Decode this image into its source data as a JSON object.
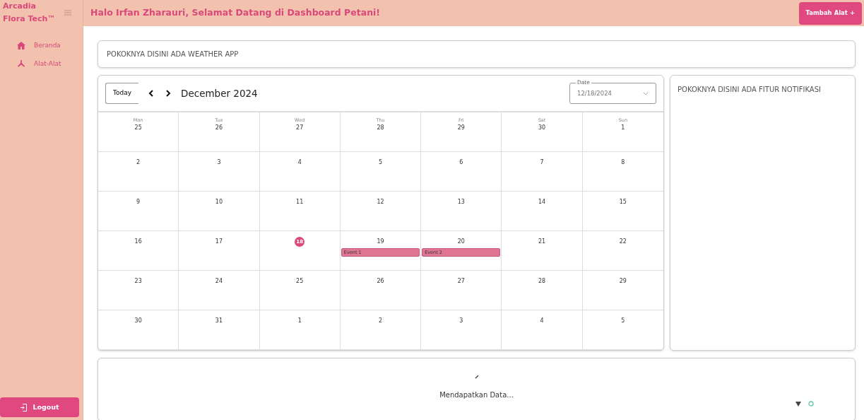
{
  "sidebar": {
    "brand": "Arcadia Flora Tech™",
    "items": [
      {
        "label": "Beranda",
        "kind": "home"
      },
      {
        "label": "Alat-Alat",
        "kind": "tools"
      }
    ],
    "logout": "Logout"
  },
  "header": {
    "greeting": "Halo Irfan Zharauri, Selamat Datang di Dashboard Petani!",
    "add_button": "Tambah Alat +"
  },
  "weather": {
    "text": "POKOKNYA DISINI ADA WEATHER APP"
  },
  "calendar": {
    "today_button": "Today",
    "month": "December 2024",
    "date_field": {
      "label": "Date",
      "value": "12/18/2024"
    },
    "weekdays": [
      "Mon",
      "Tue",
      "Wed",
      "Thu",
      "Fri",
      "Sat",
      "Sun"
    ],
    "weeks": [
      [
        {
          "day": "25",
          "selected": false
        },
        {
          "day": "26",
          "selected": false
        },
        {
          "day": "27",
          "selected": false
        },
        {
          "day": "28",
          "selected": false
        },
        {
          "day": "29",
          "selected": false
        },
        {
          "day": "30",
          "selected": false
        },
        {
          "day": "1",
          "selected": false
        }
      ],
      [
        {
          "day": "2",
          "selected": false
        },
        {
          "day": "3",
          "selected": false
        },
        {
          "day": "4",
          "selected": false
        },
        {
          "day": "5",
          "selected": false
        },
        {
          "day": "6",
          "selected": false
        },
        {
          "day": "7",
          "selected": false
        },
        {
          "day": "8",
          "selected": false
        }
      ],
      [
        {
          "day": "9",
          "selected": false
        },
        {
          "day": "10",
          "selected": false
        },
        {
          "day": "11",
          "selected": false
        },
        {
          "day": "12",
          "selected": false
        },
        {
          "day": "13",
          "selected": false
        },
        {
          "day": "14",
          "selected": false
        },
        {
          "day": "15",
          "selected": false
        }
      ],
      [
        {
          "day": "16",
          "selected": false
        },
        {
          "day": "17",
          "selected": false
        },
        {
          "day": "18",
          "selected": true
        },
        {
          "day": "19",
          "selected": false,
          "events": [
            "Event 1"
          ]
        },
        {
          "day": "20",
          "selected": false,
          "events": [
            "Event 2"
          ]
        },
        {
          "day": "21",
          "selected": false
        },
        {
          "day": "22",
          "selected": false
        }
      ],
      [
        {
          "day": "23",
          "selected": false
        },
        {
          "day": "24",
          "selected": false
        },
        {
          "day": "25",
          "selected": false
        },
        {
          "day": "26",
          "selected": false
        },
        {
          "day": "27",
          "selected": false
        },
        {
          "day": "28",
          "selected": false
        },
        {
          "day": "29",
          "selected": false
        }
      ],
      [
        {
          "day": "30",
          "selected": false
        },
        {
          "day": "31",
          "selected": false
        },
        {
          "day": "1",
          "selected": false
        },
        {
          "day": "2",
          "selected": false
        },
        {
          "day": "3",
          "selected": false
        },
        {
          "day": "4",
          "selected": false
        },
        {
          "day": "5",
          "selected": false
        }
      ]
    ]
  },
  "notifications": {
    "text": "POKOKNYA DISINI ADA FITUR NOTIFIKASI"
  },
  "loading": {
    "text": "Mendapatkan Data..."
  }
}
